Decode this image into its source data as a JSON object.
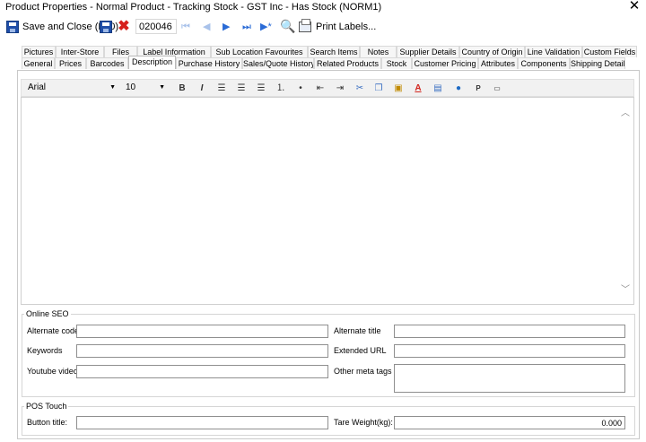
{
  "window": {
    "title": "Product Properties - Normal Product - Tracking Stock - GST Inc - Has Stock (NORM1)",
    "close_icon": "close-icon"
  },
  "toolbar": {
    "save_close_label": "Save and Close (F10)",
    "product_code": "020046",
    "print_labels_label": "Print Labels..."
  },
  "tabs": {
    "row1": [
      "Pictures",
      "Inter-Store",
      "Files",
      "Label Information",
      "Sub Location Favourites",
      "Search Items",
      "Notes",
      "Supplier Details",
      "Country of Origin",
      "Line Validation",
      "Custom Fields"
    ],
    "row2": [
      "General",
      "Prices",
      "Barcodes",
      "Description",
      "Purchase History",
      "Sales/Quote History",
      "Related Products",
      "Stock",
      "Customer Pricing",
      "Attributes",
      "Components",
      "Shipping Details"
    ],
    "active": "Description"
  },
  "editor": {
    "font": "Arial",
    "size": "10",
    "bold": "B",
    "italic": "I",
    "paragraph": "P"
  },
  "seo": {
    "legend": "Online SEO",
    "alternate_code_label": "Alternate code",
    "alternate_code_value": "",
    "alternate_title_label": "Alternate title",
    "alternate_title_value": "",
    "keywords_label": "Keywords",
    "keywords_value": "",
    "extended_url_label": "Extended URL",
    "extended_url_value": "",
    "youtube_label": "Youtube video",
    "youtube_value": "",
    "other_meta_label": "Other meta tags",
    "other_meta_value": ""
  },
  "pos": {
    "legend": "POS Touch",
    "button_title_label": "Button title:",
    "button_title_value": "",
    "tare_weight_label": "Tare Weight(kg):",
    "tare_weight_value": "0.000"
  }
}
